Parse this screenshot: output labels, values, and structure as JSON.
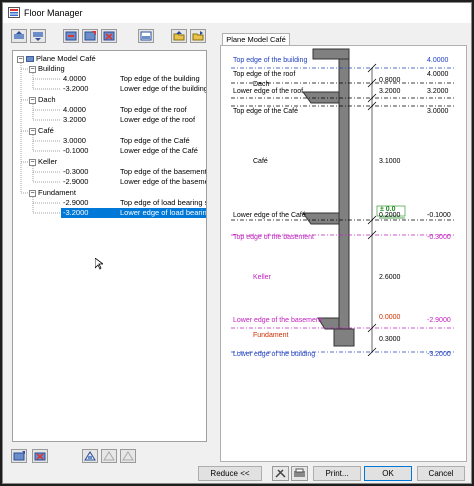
{
  "window": {
    "title": "Floor Manager"
  },
  "toolbar": {
    "icons": [
      "floor-up-icon",
      "floor-down-icon",
      "add-floor-icon",
      "add-level-icon",
      "delete-level-icon",
      "level-settings-icon",
      "import-icon",
      "export-icon"
    ]
  },
  "tree": {
    "root": "Plane Model Café",
    "groups": [
      {
        "name": "Building",
        "rows": [
          {
            "value": "4.0000",
            "desc": "Top edge of the building"
          },
          {
            "value": "-3.2000",
            "desc": "Lower edge of the building"
          }
        ]
      },
      {
        "name": "Dach",
        "rows": [
          {
            "value": "4.0000",
            "desc": "Top edge of the roof"
          },
          {
            "value": "3.2000",
            "desc": "Lower edge of the roof"
          }
        ]
      },
      {
        "name": "Café",
        "rows": [
          {
            "value": "3.0000",
            "desc": "Top edge of the Café"
          },
          {
            "value": "-0.1000",
            "desc": "Lower edge of the Café"
          }
        ]
      },
      {
        "name": "Keller",
        "rows": [
          {
            "value": "-0.3000",
            "desc": "Top edge of the basement"
          },
          {
            "value": "-2.9000",
            "desc": "Lower edge of the basement"
          }
        ]
      },
      {
        "name": "Fundament",
        "rows": [
          {
            "value": "-2.9000",
            "desc": "Top edge of load bearing slab"
          },
          {
            "value": "-3.2000",
            "desc": "Lower edge of load bearing slab",
            "selected": true
          }
        ]
      }
    ]
  },
  "tab": {
    "label": "Plane Model Café"
  },
  "diagram": {
    "levels": [
      {
        "label": "Top edge of the building",
        "value": "4.0000",
        "color": "#1f3fbf"
      },
      {
        "label": "Top edge of the roof",
        "value": "4.0000",
        "color": "#000000"
      },
      {
        "label": "Lower edge of the roof",
        "value": "3.2000",
        "color": "#000000"
      },
      {
        "label": "Top edge of the Café",
        "value": "3.0000",
        "color": "#000000"
      },
      {
        "label": "Lower edge of the Café",
        "value": "-0.1000",
        "color": "#000000"
      },
      {
        "label": "Top edge of the basement",
        "value": "-0.3000",
        "color": "#c020c0"
      },
      {
        "label": "Lower edge of the basement",
        "value": "-2.9000",
        "color": "#c020c0"
      },
      {
        "label": "Lower edge of the building",
        "value": "-3.2000",
        "color": "#1f3fbf"
      }
    ],
    "floor_names": [
      {
        "name": "Dach",
        "color": "#000000"
      },
      {
        "name": "Café",
        "color": "#000000"
      },
      {
        "name": "Keller",
        "color": "#c020c0"
      },
      {
        "name": "Fundament",
        "color": "#d03000"
      }
    ],
    "thicknesses": [
      "0.8000",
      "0.2000",
      "3.1000",
      "0.2000",
      "2.6000",
      "0.0000",
      "0.3000"
    ],
    "zero_mark": "± 0.0"
  },
  "bottom_icons": [
    "new-floor-icon",
    "delete-floor-icon",
    "level-a-icon",
    "level-b-icon",
    "level-c-icon"
  ],
  "buttons": {
    "reduce": "Reduce <<",
    "print": "Print...",
    "ok": "OK",
    "cancel": "Cancel"
  }
}
